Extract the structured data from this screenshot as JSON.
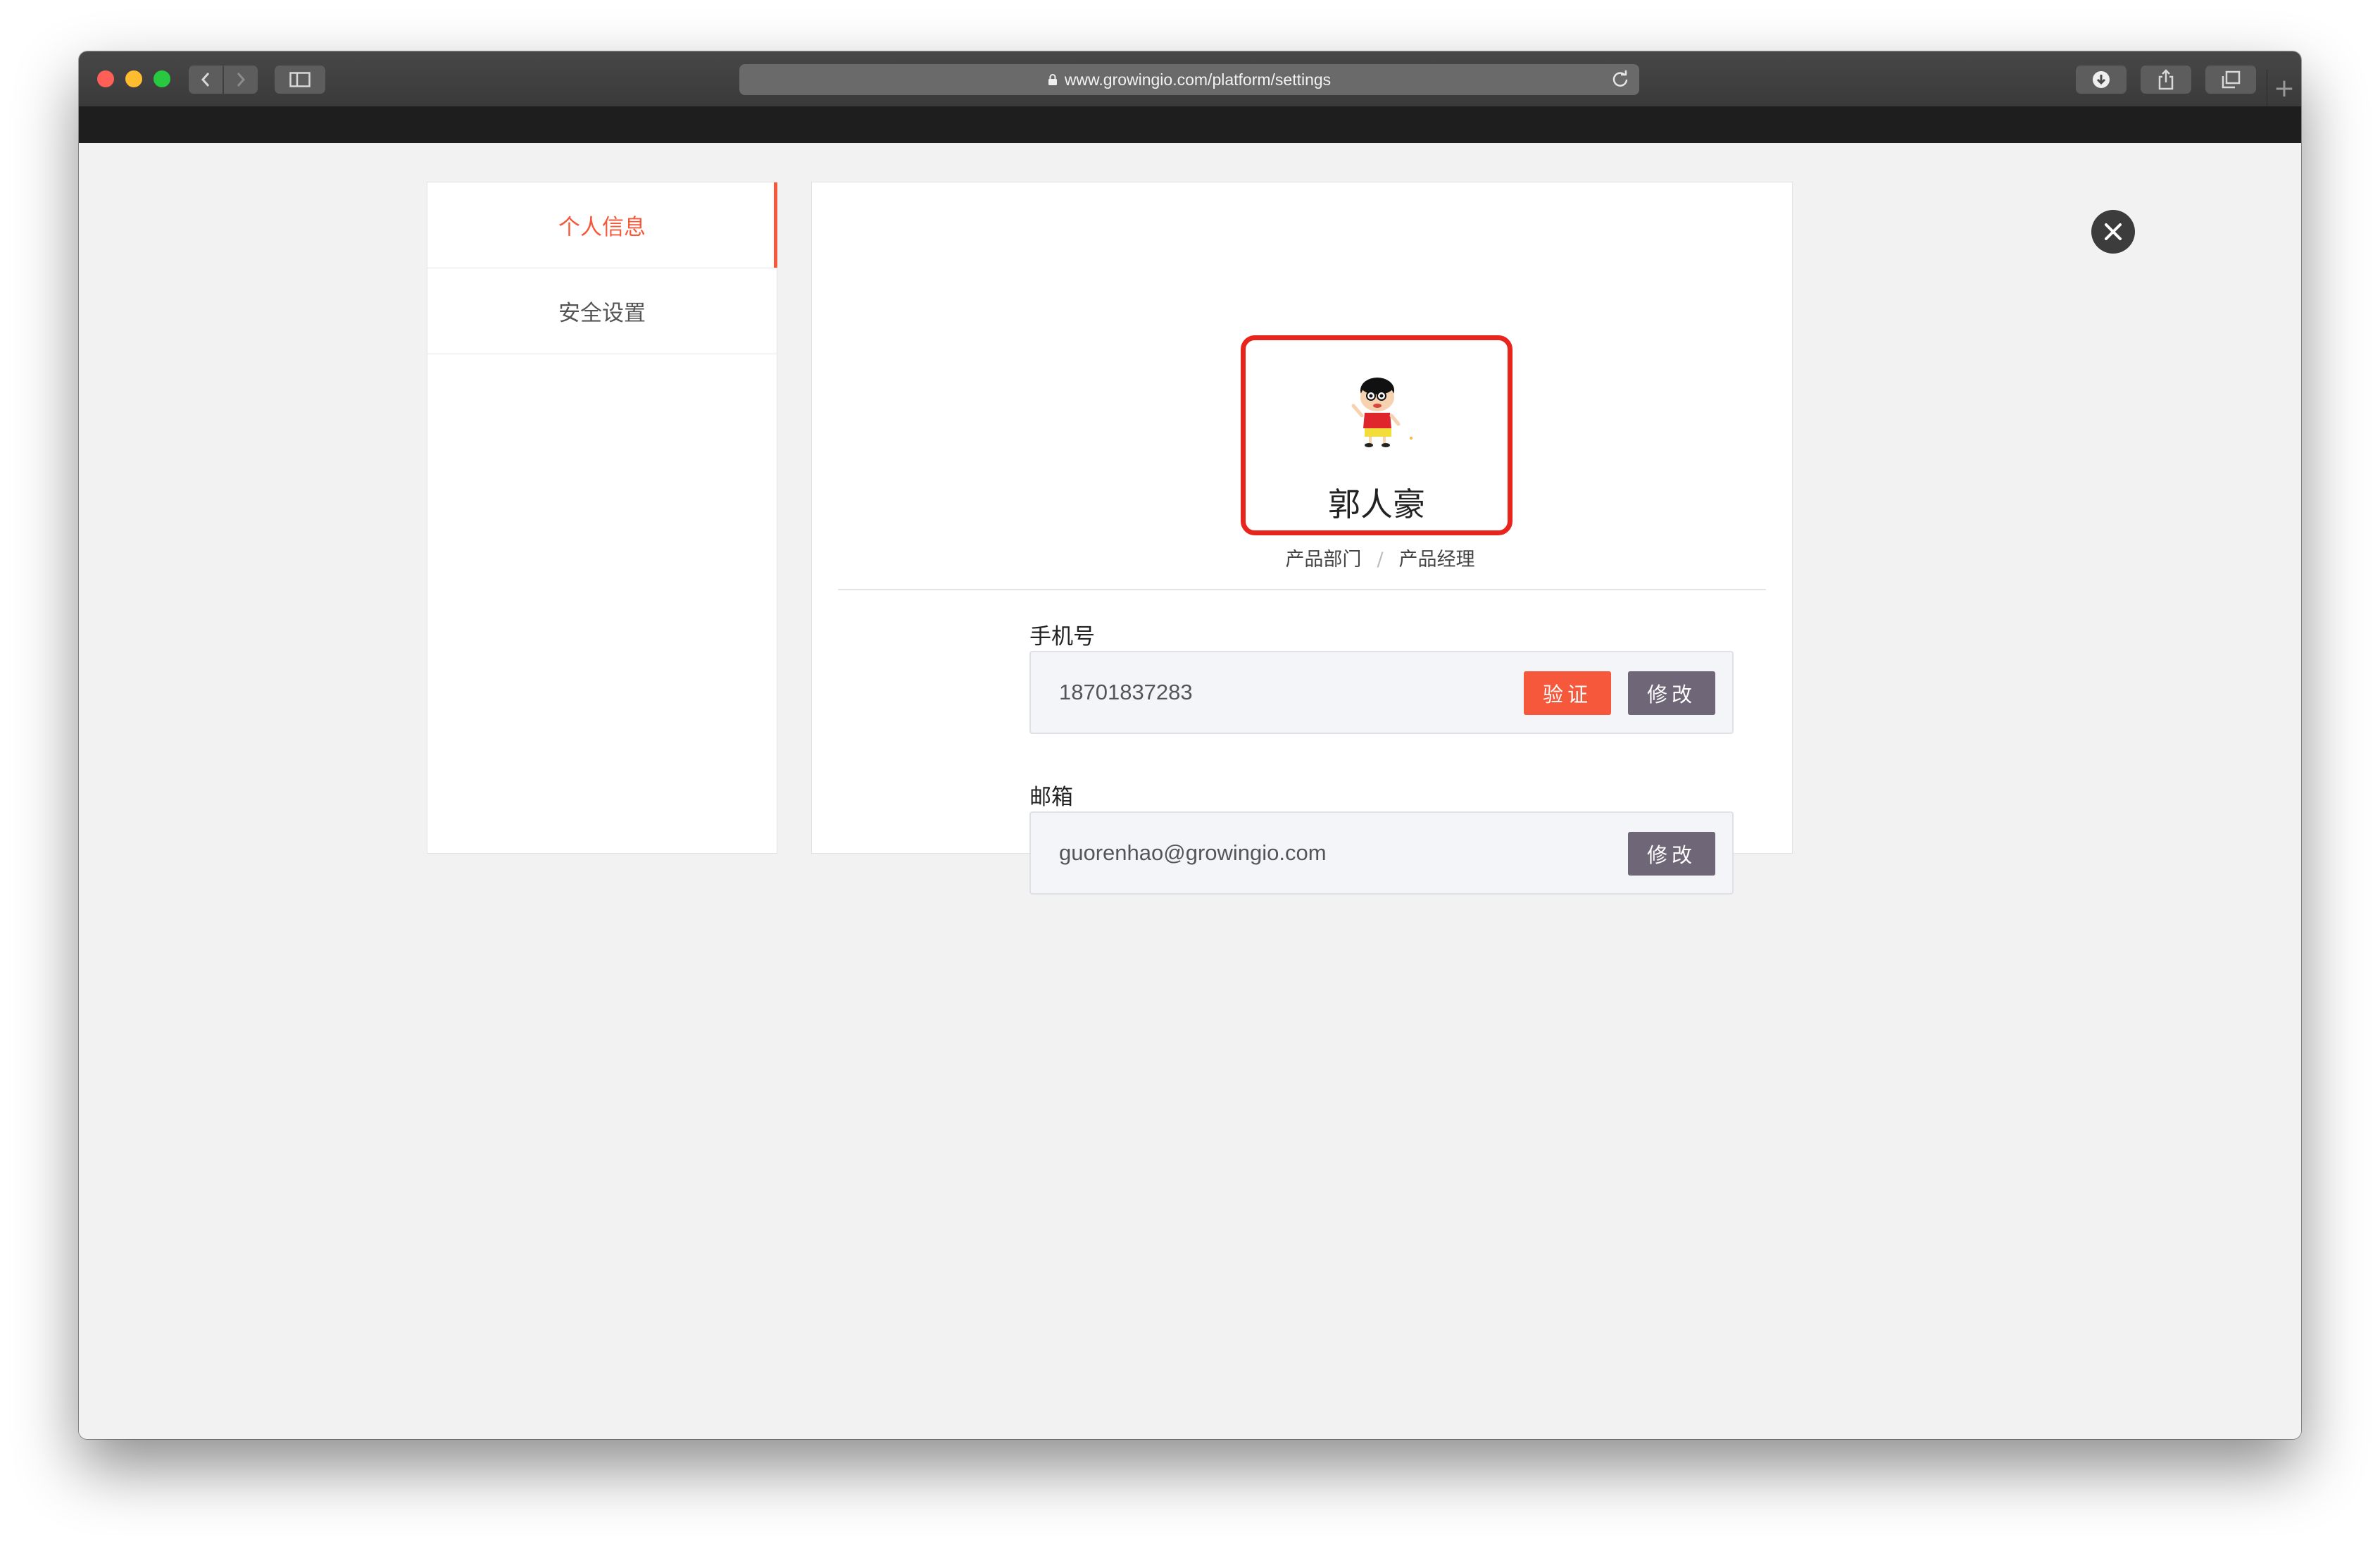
{
  "browser": {
    "url": "www.growingio.com/platform/settings"
  },
  "sidebar": {
    "items": [
      {
        "label": "个人信息",
        "active": true
      },
      {
        "label": "安全设置",
        "active": false
      }
    ]
  },
  "profile": {
    "name": "郭人豪",
    "department": "产品部门",
    "separator": "/",
    "title": "产品经理",
    "avatar": "cartoon-avatar-icon"
  },
  "fields": {
    "phone": {
      "label": "手机号",
      "value": "18701837283",
      "verify_label": "验证",
      "edit_label": "修改"
    },
    "email": {
      "label": "邮箱",
      "value": "guorenhao@growingio.com",
      "edit_label": "修改"
    }
  },
  "colors": {
    "accent": "#f5583a",
    "edit_button": "#6f6678",
    "highlight_box": "#e8251d",
    "page_bg": "#f2f2f2"
  }
}
